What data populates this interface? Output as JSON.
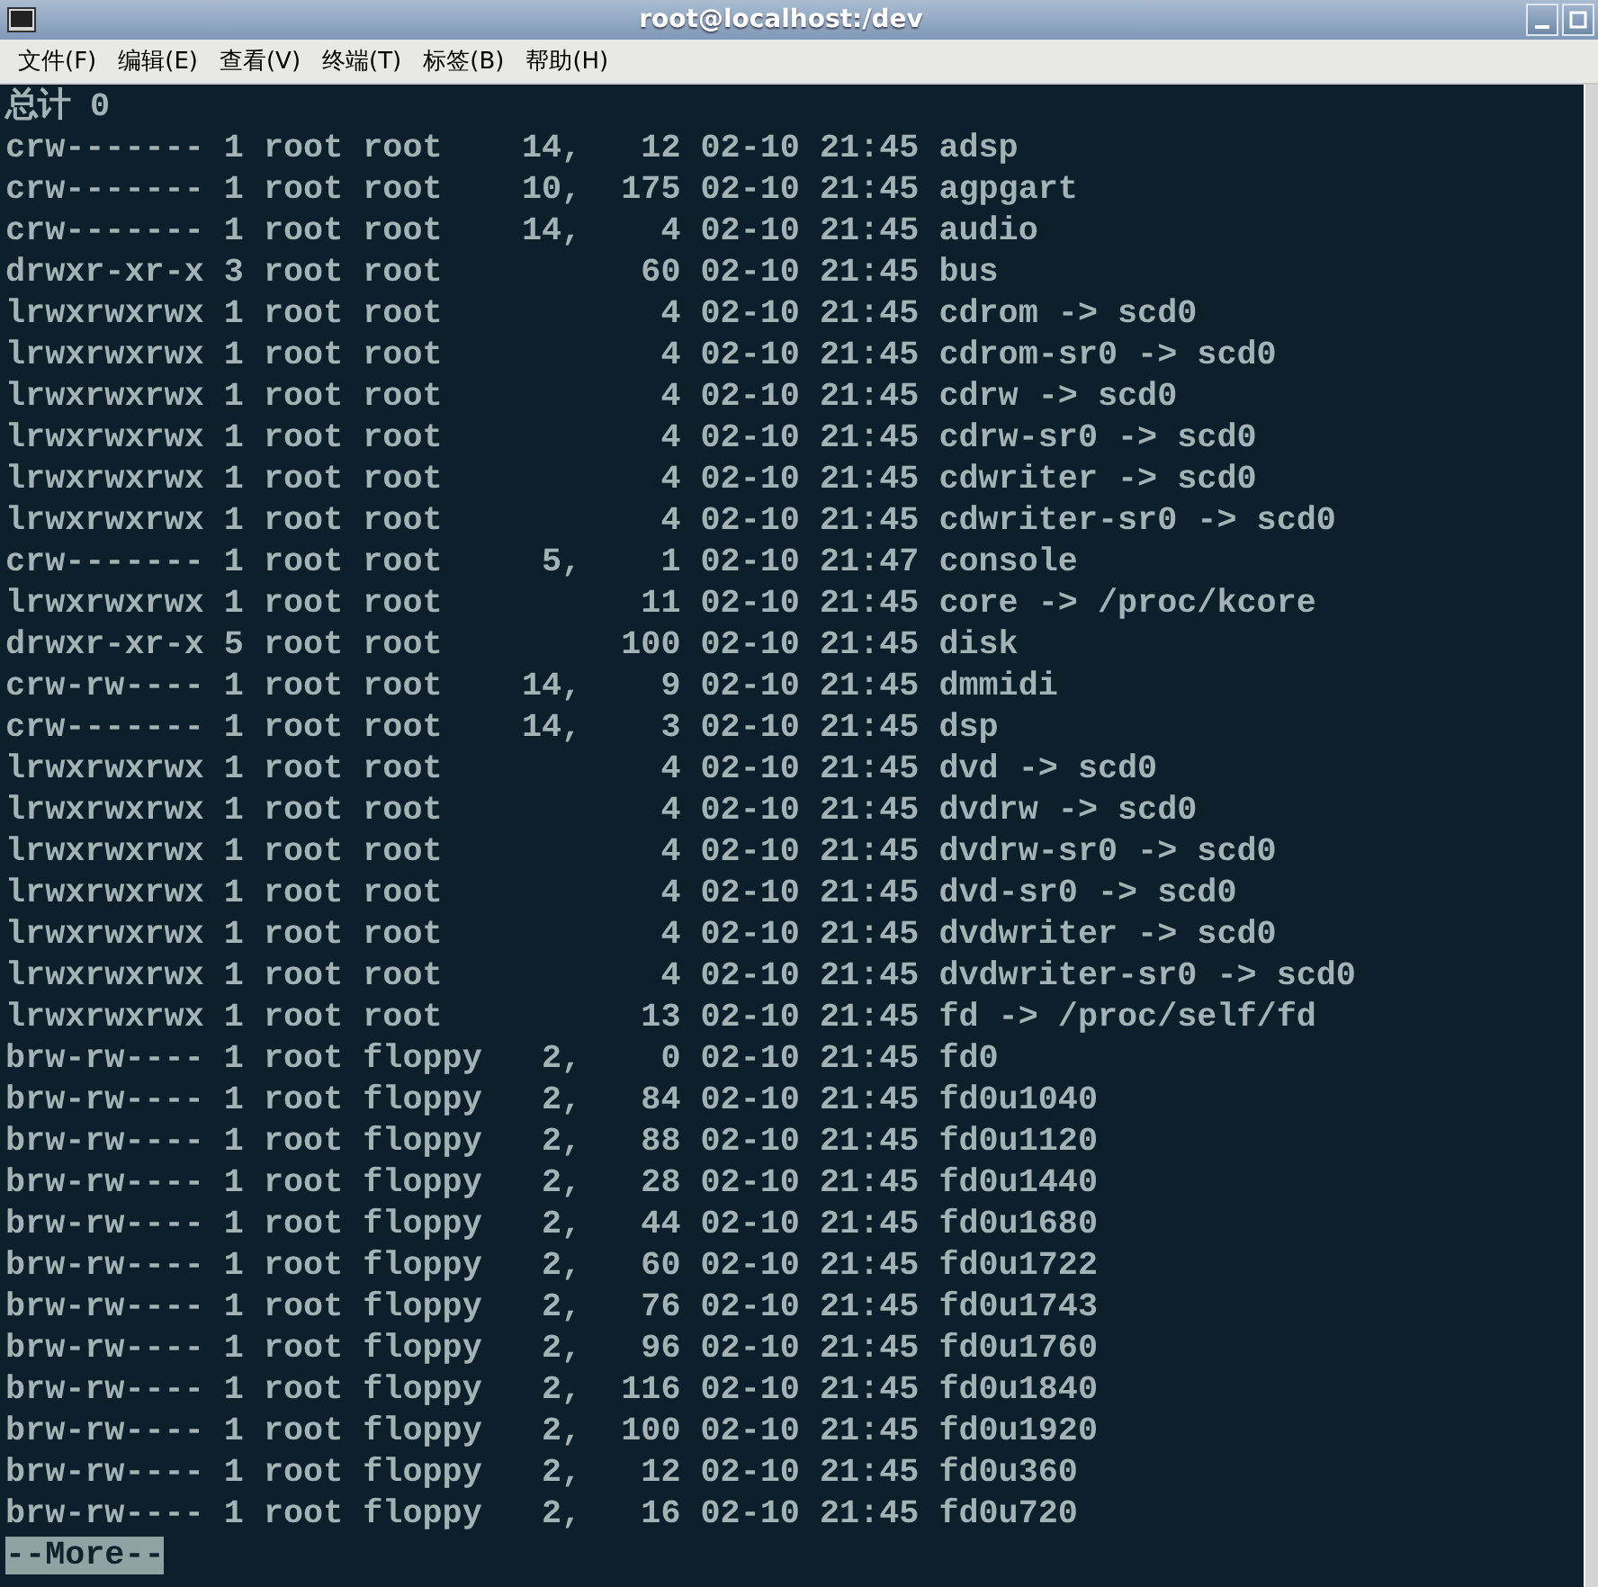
{
  "window": {
    "title": "root@localhost:/dev"
  },
  "menu": [
    {
      "label": "文件(F)"
    },
    {
      "label": "编辑(E)"
    },
    {
      "label": "查看(V)"
    },
    {
      "label": "终端(T)"
    },
    {
      "label": "标签(B)"
    },
    {
      "label": "帮助(H)"
    }
  ],
  "terminal": {
    "lines": [
      "总计 0",
      "crw------- 1 root root    14,   12 02-10 21:45 adsp",
      "crw------- 1 root root    10,  175 02-10 21:45 agpgart",
      "crw------- 1 root root    14,    4 02-10 21:45 audio",
      "drwxr-xr-x 3 root root          60 02-10 21:45 bus",
      "lrwxrwxrwx 1 root root           4 02-10 21:45 cdrom -> scd0",
      "lrwxrwxrwx 1 root root           4 02-10 21:45 cdrom-sr0 -> scd0",
      "lrwxrwxrwx 1 root root           4 02-10 21:45 cdrw -> scd0",
      "lrwxrwxrwx 1 root root           4 02-10 21:45 cdrw-sr0 -> scd0",
      "lrwxrwxrwx 1 root root           4 02-10 21:45 cdwriter -> scd0",
      "lrwxrwxrwx 1 root root           4 02-10 21:45 cdwriter-sr0 -> scd0",
      "crw------- 1 root root     5,    1 02-10 21:47 console",
      "lrwxrwxrwx 1 root root          11 02-10 21:45 core -> /proc/kcore",
      "drwxr-xr-x 5 root root         100 02-10 21:45 disk",
      "crw-rw---- 1 root root    14,    9 02-10 21:45 dmmidi",
      "crw------- 1 root root    14,    3 02-10 21:45 dsp",
      "lrwxrwxrwx 1 root root           4 02-10 21:45 dvd -> scd0",
      "lrwxrwxrwx 1 root root           4 02-10 21:45 dvdrw -> scd0",
      "lrwxrwxrwx 1 root root           4 02-10 21:45 dvdrw-sr0 -> scd0",
      "lrwxrwxrwx 1 root root           4 02-10 21:45 dvd-sr0 -> scd0",
      "lrwxrwxrwx 1 root root           4 02-10 21:45 dvdwriter -> scd0",
      "lrwxrwxrwx 1 root root           4 02-10 21:45 dvdwriter-sr0 -> scd0",
      "lrwxrwxrwx 1 root root          13 02-10 21:45 fd -> /proc/self/fd",
      "brw-rw---- 1 root floppy   2,    0 02-10 21:45 fd0",
      "brw-rw---- 1 root floppy   2,   84 02-10 21:45 fd0u1040",
      "brw-rw---- 1 root floppy   2,   88 02-10 21:45 fd0u1120",
      "brw-rw---- 1 root floppy   2,   28 02-10 21:45 fd0u1440",
      "brw-rw---- 1 root floppy   2,   44 02-10 21:45 fd0u1680",
      "brw-rw---- 1 root floppy   2,   60 02-10 21:45 fd0u1722",
      "brw-rw---- 1 root floppy   2,   76 02-10 21:45 fd0u1743",
      "brw-rw---- 1 root floppy   2,   96 02-10 21:45 fd0u1760",
      "brw-rw---- 1 root floppy   2,  116 02-10 21:45 fd0u1840",
      "brw-rw---- 1 root floppy   2,  100 02-10 21:45 fd0u1920",
      "brw-rw---- 1 root floppy   2,   12 02-10 21:45 fd0u360",
      "brw-rw---- 1 root floppy   2,   16 02-10 21:45 fd0u720"
    ],
    "prompt": "--More--"
  }
}
